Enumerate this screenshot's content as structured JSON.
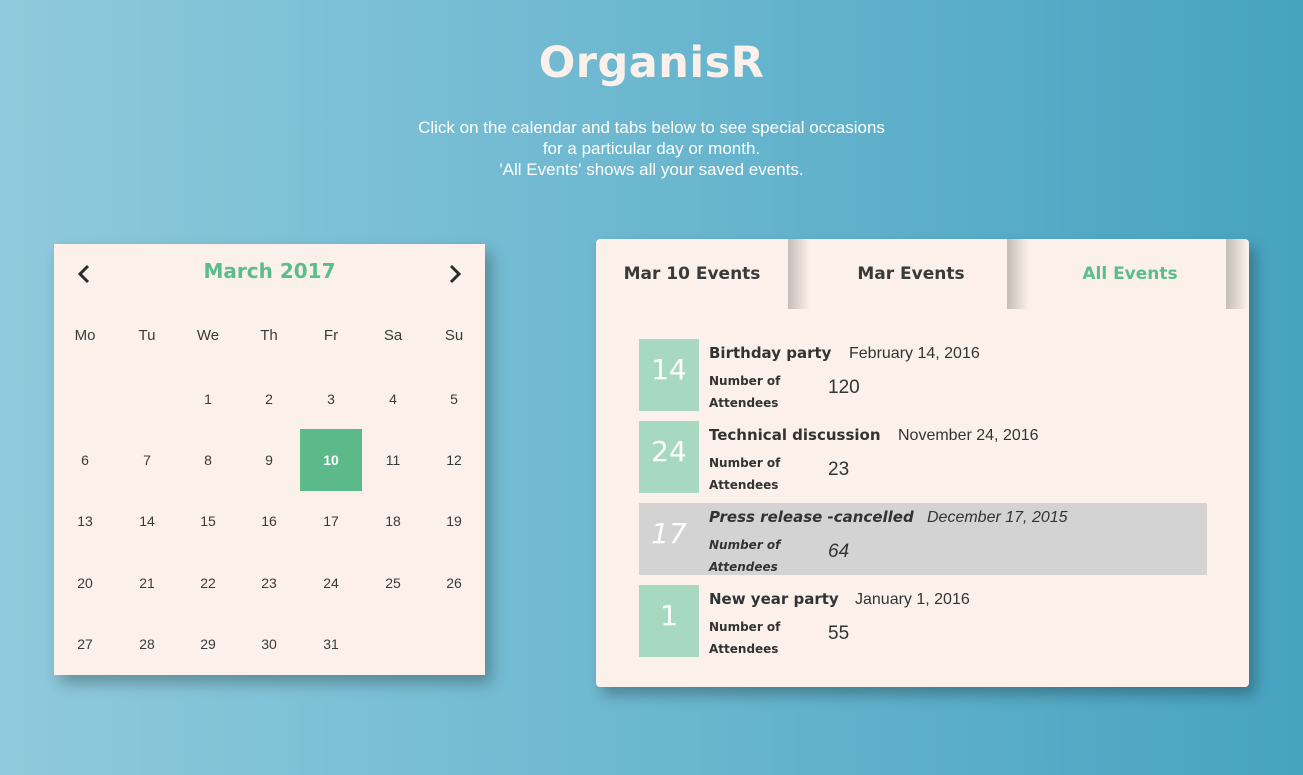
{
  "app": {
    "title": "OrganisR",
    "subtitle_lines": [
      "Click on the calendar and tabs below to see special occasions",
      "for a particular day or month.",
      "'All Events' shows all your saved events."
    ]
  },
  "calendar": {
    "month_label": "March 2017",
    "prev_icon": "chevron-left-icon",
    "next_icon": "chevron-right-icon",
    "weekdays": [
      "Mo",
      "Tu",
      "We",
      "Th",
      "Fr",
      "Sa",
      "Su"
    ],
    "weeks": [
      [
        "",
        "",
        "1",
        "2",
        "3",
        "4",
        "5"
      ],
      [
        "6",
        "7",
        "8",
        "9",
        "10",
        "11",
        "12"
      ],
      [
        "13",
        "14",
        "15",
        "16",
        "17",
        "18",
        "19"
      ],
      [
        "20",
        "21",
        "22",
        "23",
        "24",
        "25",
        "26"
      ],
      [
        "27",
        "28",
        "29",
        "30",
        "31",
        "",
        ""
      ]
    ],
    "selected_day": "10",
    "selected_color": "#5bb98a",
    "accent_color": "#5bbd8b"
  },
  "events_panel": {
    "tabs": [
      {
        "label": "Mar 10 Events",
        "active": false
      },
      {
        "label": "Mar Events",
        "active": false
      },
      {
        "label": "All Events",
        "active": true
      }
    ],
    "attendees_label": "Number of Attendees",
    "events": [
      {
        "day": "14",
        "title": "Birthday party",
        "date": "February 14, 2016",
        "attendees": "120",
        "cancelled": false
      },
      {
        "day": "24",
        "title": "Technical discussion",
        "date": "November 24, 2016",
        "attendees": "23",
        "cancelled": false
      },
      {
        "day": "17",
        "title": "Press release -cancelled",
        "date": "December 17, 2015",
        "attendees": "64",
        "cancelled": true
      },
      {
        "day": "1",
        "title": "New year party",
        "date": "January 1, 2016",
        "attendees": "55",
        "cancelled": false
      }
    ]
  }
}
